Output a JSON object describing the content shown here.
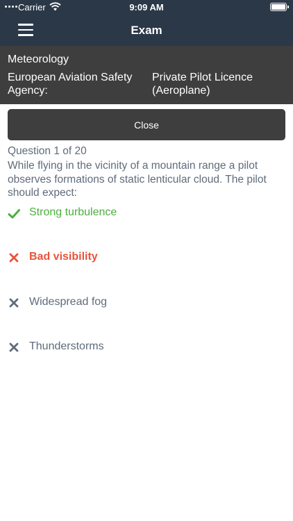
{
  "status_bar": {
    "carrier": "Carrier",
    "time": "9:09 AM"
  },
  "nav": {
    "title": "Exam"
  },
  "info": {
    "subject": "Meteorology",
    "authority": "European Aviation Safety Agency:",
    "licence": "Private Pilot Licence (Aeroplane)"
  },
  "close_button": {
    "label": "Close"
  },
  "question": {
    "counter": "Question 1 of 20",
    "text": "While flying in the vicinity of a mountain range a pilot observes formations of static lenticular cloud. The pilot should expect:",
    "answers": [
      {
        "label": "Strong turbulence",
        "state": "correct",
        "icon": "check-icon"
      },
      {
        "label": "Bad visibility",
        "state": "wrong",
        "icon": "cross-icon"
      },
      {
        "label": "Widespread fog",
        "state": "neutral",
        "icon": "cross-icon"
      },
      {
        "label": "Thunderstorms",
        "state": "neutral",
        "icon": "cross-icon"
      }
    ]
  },
  "colors": {
    "header_bg": "#2b3848",
    "panel_bg": "#3e3e3e",
    "correct": "#4caf3e",
    "wrong": "#e8533a",
    "neutral": "#5f6b7a"
  }
}
